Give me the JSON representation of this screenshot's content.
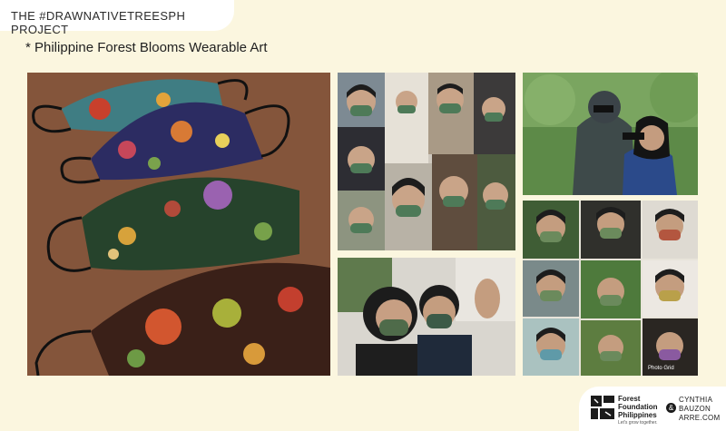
{
  "header": {
    "project_title": "THE #DRAWNATIVETREESPH PROJECT",
    "subtitle": "* Philippine Forest Blooms Wearable Art"
  },
  "photos": {
    "masks_closeup": "Four floral printed face masks on a wooden table",
    "group_selfies": "Grid of people wearing floral masks",
    "couple_selfie": "Couple selfie wearing floral masks",
    "birdwatchers": "Two birdwatchers with binoculars wearing masks",
    "portrait_grid": "Grid of portraits wearing floral masks",
    "watermark": "Photo Grid"
  },
  "footer": {
    "ffp_line1": "Forest",
    "ffp_line2": "Foundation",
    "ffp_line3": "Philippines",
    "ffp_tagline": "Let's grow together.",
    "ampersand": "&",
    "cba_line1": "CYNTHIA",
    "cba_line2": "BAUZON",
    "cba_line3": "ARRE.COM"
  },
  "colors": {
    "background": "#fbf6df",
    "panel": "#ffffff"
  }
}
